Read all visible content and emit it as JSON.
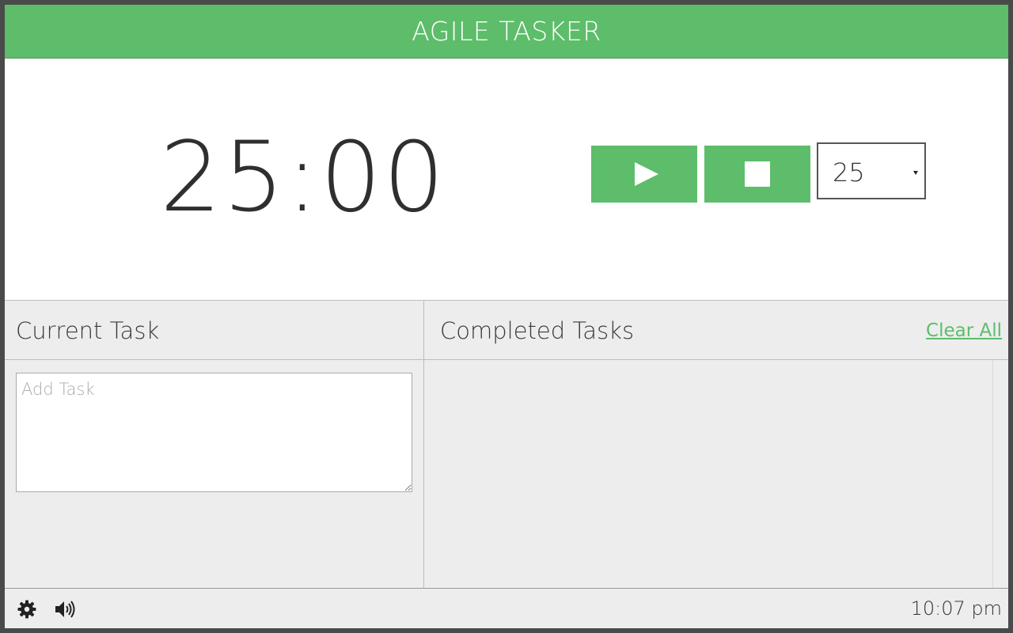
{
  "app": {
    "title": "AGILE TASKER",
    "accent_color": "#5dbd6a"
  },
  "timer": {
    "display": "25:00",
    "play_icon": "play-icon",
    "stop_icon": "stop-icon",
    "duration_selected": "25"
  },
  "current_task": {
    "title": "Current Task",
    "input_placeholder": "Add Task",
    "input_value": ""
  },
  "completed_tasks": {
    "title": "Completed Tasks",
    "clear_all_label": "Clear All",
    "items": []
  },
  "footer": {
    "settings_icon": "gear-icon",
    "sound_icon": "speaker-icon",
    "clock": "10:07 pm"
  }
}
